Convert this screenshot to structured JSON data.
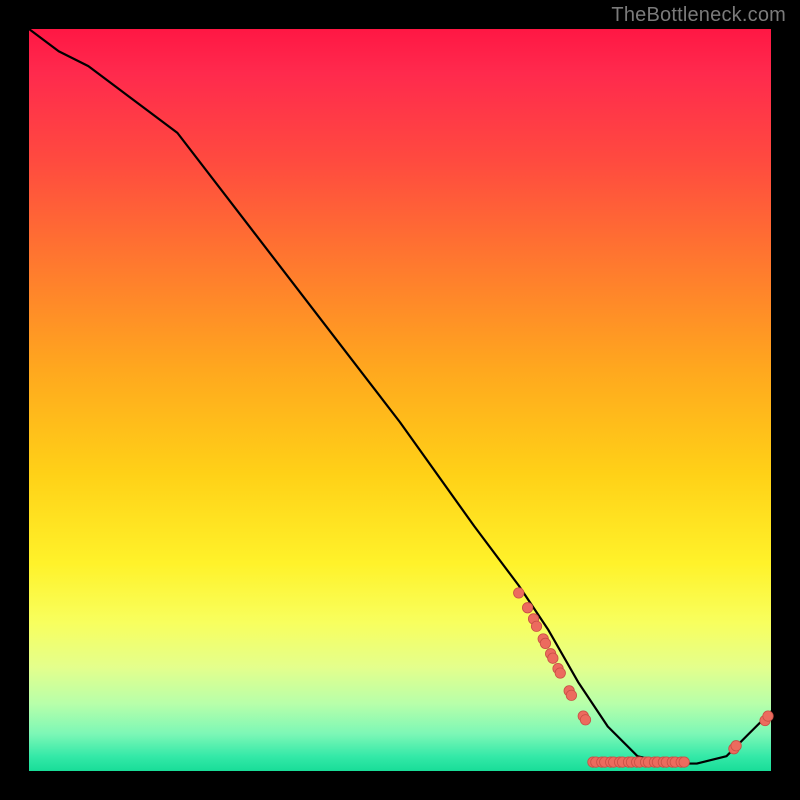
{
  "attribution": "TheBottleneck.com",
  "marker_color": "#ec6b5e",
  "marker_stroke": "#c94f45",
  "curve_color": "#000000",
  "chart_data": {
    "type": "line",
    "title": "",
    "xlabel": "",
    "ylabel": "",
    "xlim": [
      0,
      100
    ],
    "ylim": [
      0,
      100
    ],
    "series": [
      {
        "name": "bottleneck-curve",
        "x": [
          0,
          4,
          8,
          12,
          16,
          20,
          30,
          40,
          50,
          60,
          66,
          70,
          74,
          78,
          82,
          86,
          90,
          94,
          97,
          100
        ],
        "y": [
          100,
          97,
          95,
          92,
          89,
          86,
          73,
          60,
          47,
          33,
          25,
          19,
          12,
          6,
          2,
          1,
          1,
          2,
          5,
          8
        ]
      }
    ],
    "scatter_points": {
      "name": "highlighted-configs",
      "color_hint": "salmon",
      "points": [
        {
          "x": 66.0,
          "y": 24.0
        },
        {
          "x": 67.2,
          "y": 22.0
        },
        {
          "x": 68.0,
          "y": 20.5
        },
        {
          "x": 68.4,
          "y": 19.5
        },
        {
          "x": 69.3,
          "y": 17.8
        },
        {
          "x": 69.6,
          "y": 17.2
        },
        {
          "x": 70.3,
          "y": 15.8
        },
        {
          "x": 70.6,
          "y": 15.2
        },
        {
          "x": 71.3,
          "y": 13.8
        },
        {
          "x": 71.6,
          "y": 13.2
        },
        {
          "x": 72.8,
          "y": 10.8
        },
        {
          "x": 73.1,
          "y": 10.2
        },
        {
          "x": 74.7,
          "y": 7.4
        },
        {
          "x": 75.0,
          "y": 6.9
        },
        {
          "x": 76.0,
          "y": 1.2
        },
        {
          "x": 76.4,
          "y": 1.2
        },
        {
          "x": 77.2,
          "y": 1.2
        },
        {
          "x": 77.6,
          "y": 1.2
        },
        {
          "x": 78.4,
          "y": 1.2
        },
        {
          "x": 78.8,
          "y": 1.2
        },
        {
          "x": 79.6,
          "y": 1.2
        },
        {
          "x": 80.0,
          "y": 1.2
        },
        {
          "x": 80.8,
          "y": 1.2
        },
        {
          "x": 81.2,
          "y": 1.2
        },
        {
          "x": 81.9,
          "y": 1.2
        },
        {
          "x": 82.3,
          "y": 1.2
        },
        {
          "x": 83.1,
          "y": 1.2
        },
        {
          "x": 83.5,
          "y": 1.2
        },
        {
          "x": 84.3,
          "y": 1.2
        },
        {
          "x": 84.7,
          "y": 1.2
        },
        {
          "x": 85.5,
          "y": 1.2
        },
        {
          "x": 85.9,
          "y": 1.2
        },
        {
          "x": 86.7,
          "y": 1.2
        },
        {
          "x": 87.1,
          "y": 1.2
        },
        {
          "x": 87.9,
          "y": 1.2
        },
        {
          "x": 88.3,
          "y": 1.2
        },
        {
          "x": 95.0,
          "y": 3.0
        },
        {
          "x": 95.3,
          "y": 3.4
        },
        {
          "x": 99.2,
          "y": 6.8
        },
        {
          "x": 99.6,
          "y": 7.4
        }
      ]
    }
  }
}
